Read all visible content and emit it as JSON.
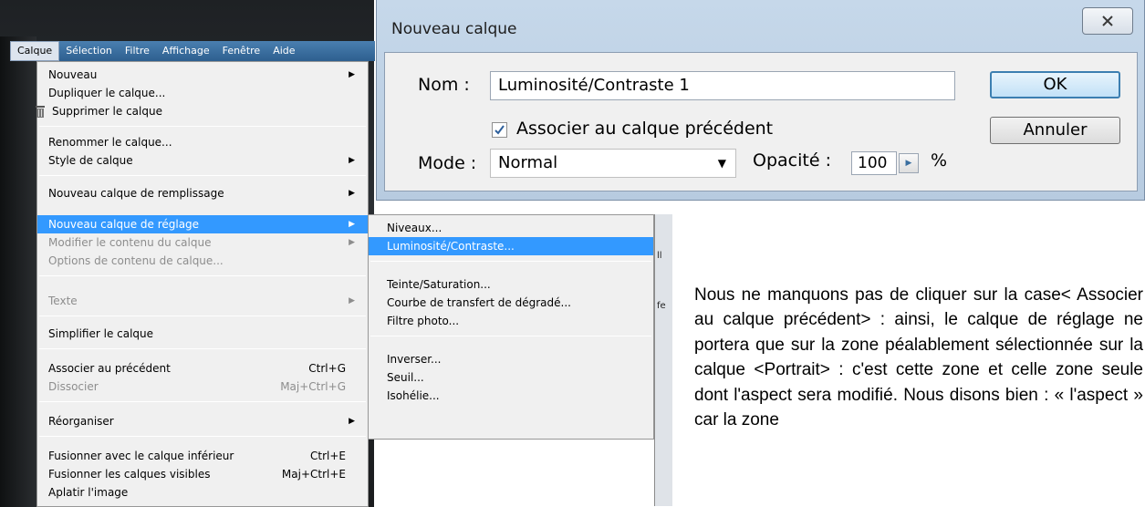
{
  "menubar": {
    "items": [
      "Calque",
      "Sélection",
      "Filtre",
      "Affichage",
      "Fenêtre",
      "Aide"
    ]
  },
  "calque_menu": {
    "items": [
      {
        "label": "Nouveau",
        "submenu": true
      },
      {
        "label": "Dupliquer le calque..."
      },
      {
        "label": "Supprimer le calque",
        "icon": "trash-icon"
      },
      {
        "label": "Renommer le calque..."
      },
      {
        "label": "Style de calque",
        "submenu": true
      },
      {
        "label": "Nouveau calque de remplissage",
        "submenu": true
      },
      {
        "label": "Nouveau calque de réglage",
        "submenu": true,
        "highlighted": true
      },
      {
        "label": "Modifier le contenu du calque",
        "submenu": true,
        "disabled": true
      },
      {
        "label": "Options de contenu de calque...",
        "disabled": true
      },
      {
        "label": "Texte",
        "submenu": true,
        "disabled": true
      },
      {
        "label": "Simplifier le calque"
      },
      {
        "label": "Associer au précédent",
        "shortcut": "Ctrl+G"
      },
      {
        "label": "Dissocier",
        "shortcut": "Maj+Ctrl+G",
        "disabled": true
      },
      {
        "label": "Réorganiser",
        "submenu": true
      },
      {
        "label": "Fusionner avec le calque inférieur",
        "shortcut": "Ctrl+E"
      },
      {
        "label": "Fusionner les calques visibles",
        "shortcut": "Maj+Ctrl+E"
      },
      {
        "label": "Aplatir l'image"
      }
    ]
  },
  "submenu": {
    "items": [
      {
        "label": "Niveaux..."
      },
      {
        "label": "Luminosité/Contraste...",
        "highlighted": true
      },
      {
        "label": "Teinte/Saturation..."
      },
      {
        "label": "Courbe de transfert de dégradé..."
      },
      {
        "label": "Filtre photo..."
      },
      {
        "label": "Inverser..."
      },
      {
        "label": "Seuil..."
      },
      {
        "label": "Isohélie..."
      }
    ]
  },
  "dialog": {
    "title": "Nouveau calque",
    "close_label": "X",
    "name_label": "Nom :",
    "name_value": "Luminosité/Contraste 1",
    "checkbox_label": "Associer au calque précédent",
    "checkbox_checked": true,
    "mode_label": "Mode :",
    "mode_value": "Normal",
    "opacity_label": "Opacité :",
    "opacity_value": "100",
    "percent": "%",
    "ok_label": "OK",
    "cancel_label": "Annuler"
  },
  "fragment": {
    "t1": "ll",
    "t2": "fe"
  },
  "paragraph": "Nous ne manquons pas de cliquer sur la case< Associer au calque précédent> : ainsi, le calque de réglage ne portera que sur la zone péalablement sélectionnée sur la calque <Portrait> : c'est cette zone et celle zone seule dont l'aspect sera modifié. Nous disons bien : « l'aspect » car la zone"
}
